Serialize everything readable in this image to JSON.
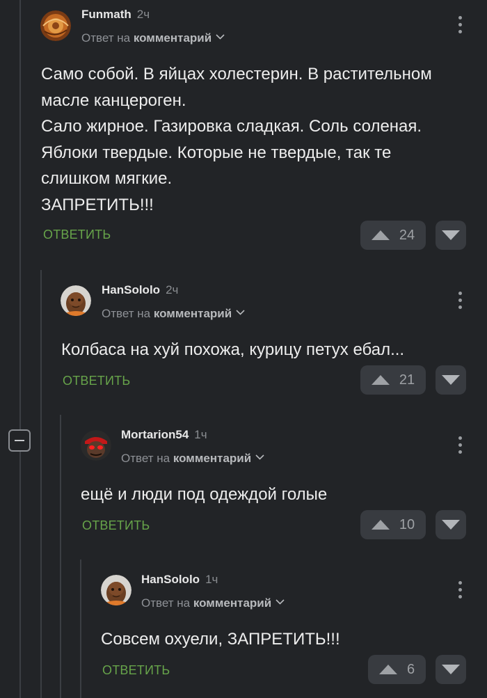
{
  "comments": [
    {
      "author": "Funmath",
      "time": "2ч",
      "reply_prefix": "Ответ на",
      "reply_target": "комментарий",
      "text_lines": [
        "Само собой. В яйцах холестерин. В растительном",
        "масле канцероген.",
        "Сало жирное. Газировка сладкая. Соль соленая.",
        "Яблоки твердые. Которые не твердые, так те",
        "слишком мягкие.",
        "ЗАПРЕТИТЬ!!!"
      ],
      "reply_label": "ОТВЕТИТЬ",
      "rating": "24"
    },
    {
      "author": "HanSololo",
      "time": "2ч",
      "reply_prefix": "Ответ на",
      "reply_target": "комментарий",
      "text_lines": [
        "Колбаса на хуй похожа, курицу петух ебал..."
      ],
      "reply_label": "ОТВЕТИТЬ",
      "rating": "21"
    },
    {
      "author": "Mortarion54",
      "time": "1ч",
      "reply_prefix": "Ответ на",
      "reply_target": "комментарий",
      "text_lines": [
        "ещё и люди под одеждой голые"
      ],
      "reply_label": "ОТВЕТИТЬ",
      "rating": "10"
    },
    {
      "author": "HanSololo",
      "time": "1ч",
      "reply_prefix": "Ответ на",
      "reply_target": "комментарий",
      "text_lines": [
        "Совсем охуели, ЗАПРЕТИТЬ!!!"
      ],
      "reply_label": "ОТВЕТИТЬ",
      "rating": "6"
    }
  ],
  "icons": {
    "upvote": "triangle-up-icon",
    "downvote": "triangle-down-icon",
    "more": "vertical-dots-icon",
    "chevron": "chevron-down-icon",
    "collapse": "minus-icon"
  },
  "colors": {
    "background": "#222427",
    "accent_green": "#67a44a",
    "vote_bg": "#383b40"
  }
}
